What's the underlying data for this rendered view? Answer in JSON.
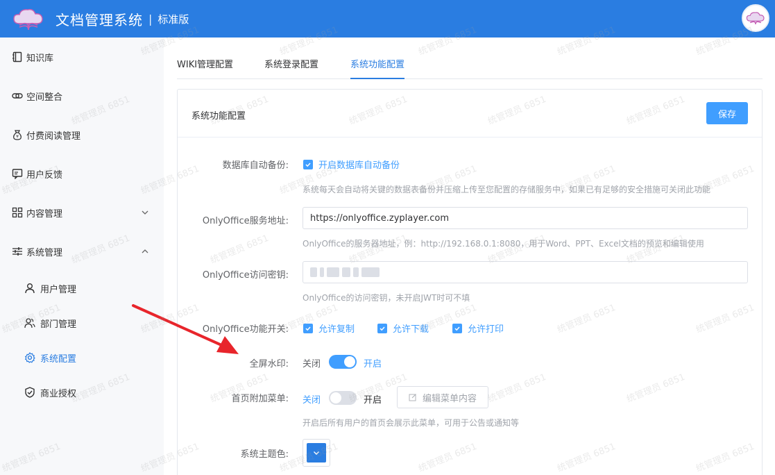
{
  "header": {
    "app_title": "文档管理系统",
    "divider": "|",
    "edition": "标准版",
    "logo_icon": "cloud-book-logo-icon",
    "avatar_icon": "avatar-icon",
    "bg_color": "#2a7de1"
  },
  "sidebar": {
    "items": [
      {
        "label": "知识库",
        "icon": "book-icon"
      },
      {
        "label": "空间整合",
        "icon": "link-icon"
      },
      {
        "label": "付费阅读管理",
        "icon": "money-bag-icon"
      },
      {
        "label": "用户反馈",
        "icon": "feedback-icon"
      },
      {
        "label": "内容管理",
        "icon": "grid-icon",
        "expanded": false
      },
      {
        "label": "系统管理",
        "icon": "sliders-icon",
        "expanded": true
      }
    ],
    "sub_items": [
      {
        "label": "用户管理",
        "icon": "user-icon"
      },
      {
        "label": "部门管理",
        "icon": "users-icon"
      },
      {
        "label": "系统配置",
        "icon": "gear-icon",
        "active": true
      },
      {
        "label": "商业授权",
        "icon": "shield-check-icon"
      }
    ]
  },
  "tabs": [
    {
      "label": "WIKI管理配置",
      "active": false
    },
    {
      "label": "系统登录配置",
      "active": false
    },
    {
      "label": "系统功能配置",
      "active": true
    }
  ],
  "card": {
    "title": "系统功能配置",
    "save_label": "保存"
  },
  "form": {
    "db_backup": {
      "label": "数据库自动备份:",
      "checkbox_label": "开启数据库自动备份",
      "checked": true,
      "help": "系统每天会自动将关键的数据表备份并压缩上传至您配置的存储服务中，如果已有足够的安全措施可关闭此功能"
    },
    "onlyoffice_url": {
      "label": "OnlyOffice服务地址:",
      "value": "https://onlyoffice.zyplayer.com",
      "help": "OnlyOffice的服务器地址，例：http://192.168.0.1:8080，用于Word、PPT、Excel文档的预览和编辑使用"
    },
    "onlyoffice_key": {
      "label": "OnlyOffice访问密钥:",
      "value_masked": true,
      "help": "OnlyOffice的访问密钥，未开启JWT时可不填"
    },
    "onlyoffice_switches": {
      "label": "OnlyOffice功能开关:",
      "options": [
        {
          "label": "允许复制",
          "checked": true
        },
        {
          "label": "允许下载",
          "checked": true
        },
        {
          "label": "允许打印",
          "checked": true
        }
      ]
    },
    "fullscreen_watermark": {
      "label": "全屏水印:",
      "off_label": "关闭",
      "on_label": "开启",
      "on": true
    },
    "home_menu": {
      "label": "首页附加菜单:",
      "off_label": "关闭",
      "on_label": "开启",
      "on": false,
      "edit_label": "编辑菜单内容",
      "help": "开启后所有用户的首页会展示此菜单，可用于公告或通知等"
    },
    "theme_color": {
      "label": "系统主题色:",
      "color": "#2a7de1"
    }
  },
  "watermark_text": "统管理员 6851",
  "accent_color": "#409eff",
  "annotation_color": "#e8252b"
}
